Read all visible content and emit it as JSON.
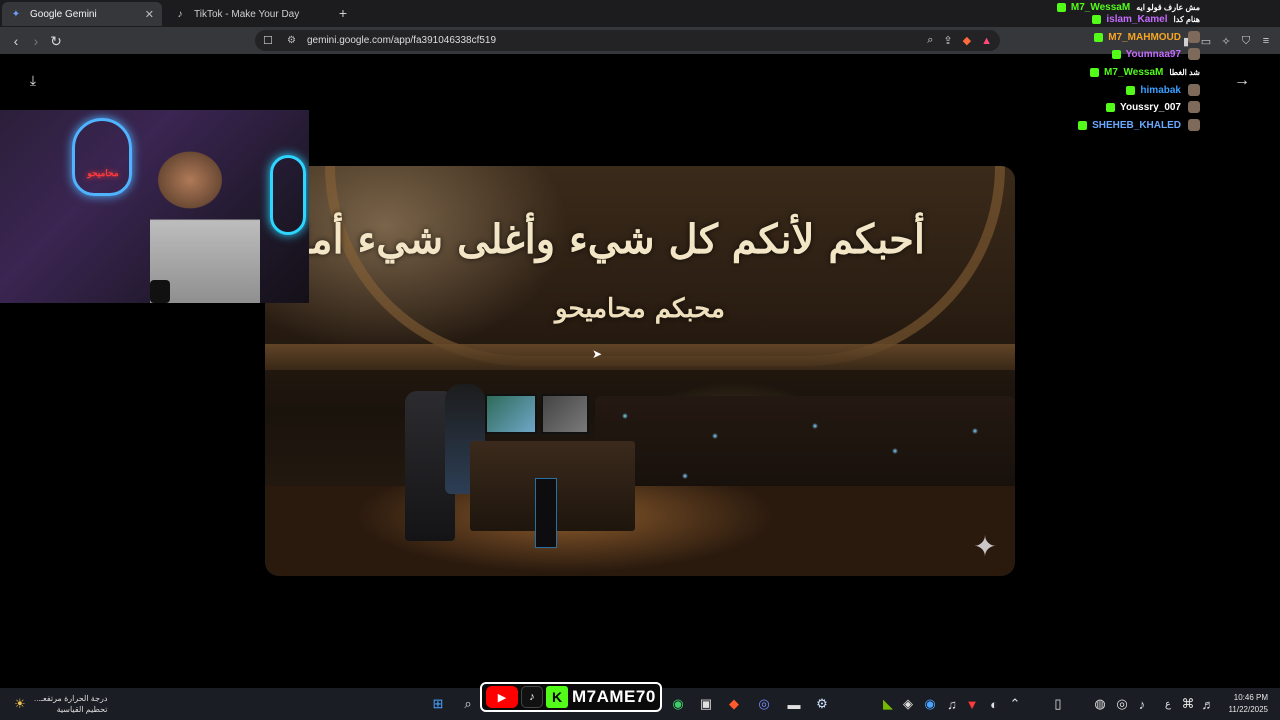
{
  "browser": {
    "tabs": [
      {
        "label": "Google Gemini",
        "icon": "gemini-icon",
        "active": true
      },
      {
        "label": "TikTok - Make Your Day",
        "icon": "tiktok-icon",
        "active": false
      }
    ],
    "url": "gemini.google.com/app/fa391046338cf519"
  },
  "image": {
    "calligraphy": "أحبكم لأنكم كل شيء وأغلى شيء أملكه",
    "signature": "محبكم محاميحو",
    "sparkle_icon": "gemini-sparkle-icon"
  },
  "webcam": {
    "neon_text": "محاميحو"
  },
  "chat": [
    {
      "user": "M7_WessaM",
      "color": "#53fc18",
      "message": "مش عارف قولو ايه"
    },
    {
      "user": "islam_Kamel",
      "color": "#c46bff",
      "message": "هنام كدا"
    },
    {
      "user": "M7_MAHMOUD",
      "color": "#f5a623",
      "message": ""
    },
    {
      "user": "Youmnaa97",
      "color": "#c46bff",
      "message": ""
    },
    {
      "user": "M7_WessaM",
      "color": "#53fc18",
      "message": "شد الغطا"
    },
    {
      "user": "himabak",
      "color": "#3aa0ff",
      "message": ""
    },
    {
      "user": "Youssry_007",
      "color": "#ffffff",
      "message": ""
    },
    {
      "user": "SHEHEB_KHALED",
      "color": "#6aa8ff",
      "message": ""
    }
  ],
  "taskbar": {
    "weather_line1": "درجة الحرارة مرتفعـ...",
    "weather_line2": "تحطيم القياسية",
    "brand_name": "M7AME70",
    "time": "10:46 PM",
    "date": "11/22/2025",
    "lang": "ع"
  }
}
